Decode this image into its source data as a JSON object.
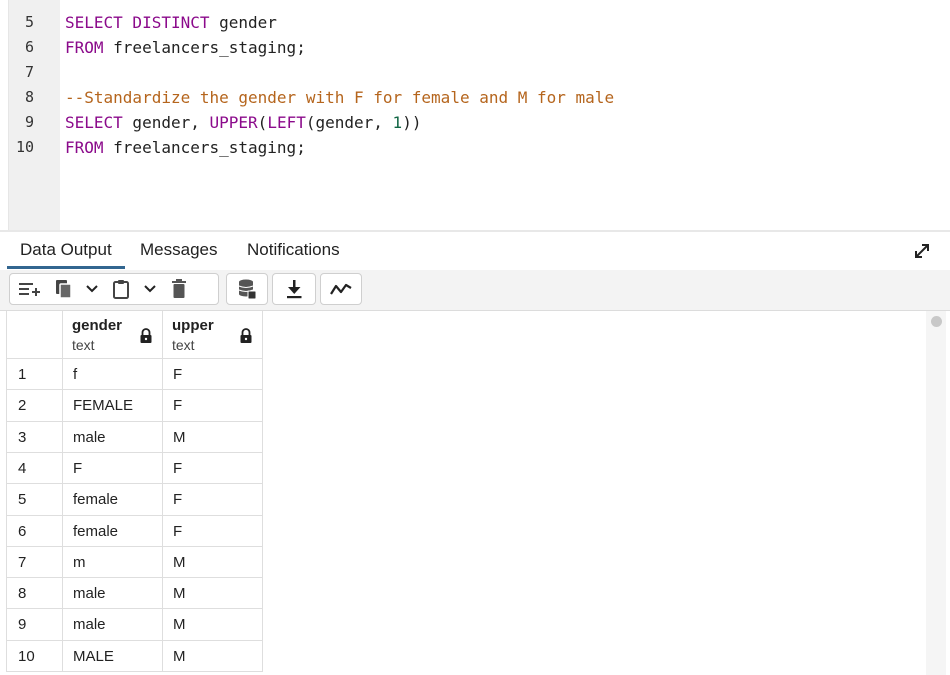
{
  "editor": {
    "lines": [
      {
        "num": "5",
        "tokens": [
          {
            "t": "SELECT DISTINCT",
            "c": "kw"
          },
          {
            "t": " gender",
            "c": ""
          }
        ]
      },
      {
        "num": "6",
        "tokens": [
          {
            "t": "FROM",
            "c": "kw"
          },
          {
            "t": " freelancers_staging;",
            "c": ""
          }
        ]
      },
      {
        "num": "7",
        "tokens": []
      },
      {
        "num": "8",
        "tokens": [
          {
            "t": "--Standardize the gender with F for female and M for male",
            "c": "cm"
          }
        ]
      },
      {
        "num": "9",
        "tokens": [
          {
            "t": "SELECT",
            "c": "kw"
          },
          {
            "t": " gender, ",
            "c": ""
          },
          {
            "t": "UPPER",
            "c": "kw"
          },
          {
            "t": "(",
            "c": ""
          },
          {
            "t": "LEFT",
            "c": "kw"
          },
          {
            "t": "(gender, ",
            "c": ""
          },
          {
            "t": "1",
            "c": "nm"
          },
          {
            "t": "))",
            "c": ""
          }
        ]
      },
      {
        "num": "10",
        "tokens": [
          {
            "t": "FROM",
            "c": "kw"
          },
          {
            "t": " freelancers_staging;",
            "c": ""
          }
        ]
      }
    ]
  },
  "tabs": {
    "data_output": "Data Output",
    "messages": "Messages",
    "notifications": "Notifications"
  },
  "toolbar": {
    "icons": [
      "add-row-icon",
      "copy-icon",
      "chevron-down-icon",
      "paste-icon",
      "chevron-down-icon",
      "delete-icon",
      "save-data-icon",
      "download-icon",
      "graph-icon"
    ]
  },
  "grid": {
    "columns": [
      {
        "name": "gender",
        "type": "text"
      },
      {
        "name": "upper",
        "type": "text"
      }
    ],
    "rows": [
      {
        "n": "1",
        "gender": "f",
        "upper": "F"
      },
      {
        "n": "2",
        "gender": "FEMALE",
        "upper": "F"
      },
      {
        "n": "3",
        "gender": "male",
        "upper": "M"
      },
      {
        "n": "4",
        "gender": "F",
        "upper": "F"
      },
      {
        "n": "5",
        "gender": "female",
        "upper": "F"
      },
      {
        "n": "6",
        "gender": "female",
        "upper": "F"
      },
      {
        "n": "7",
        "gender": "m",
        "upper": "M"
      },
      {
        "n": "8",
        "gender": "male",
        "upper": "M"
      },
      {
        "n": "9",
        "gender": "male",
        "upper": "M"
      },
      {
        "n": "10",
        "gender": "MALE",
        "upper": "M"
      }
    ]
  }
}
